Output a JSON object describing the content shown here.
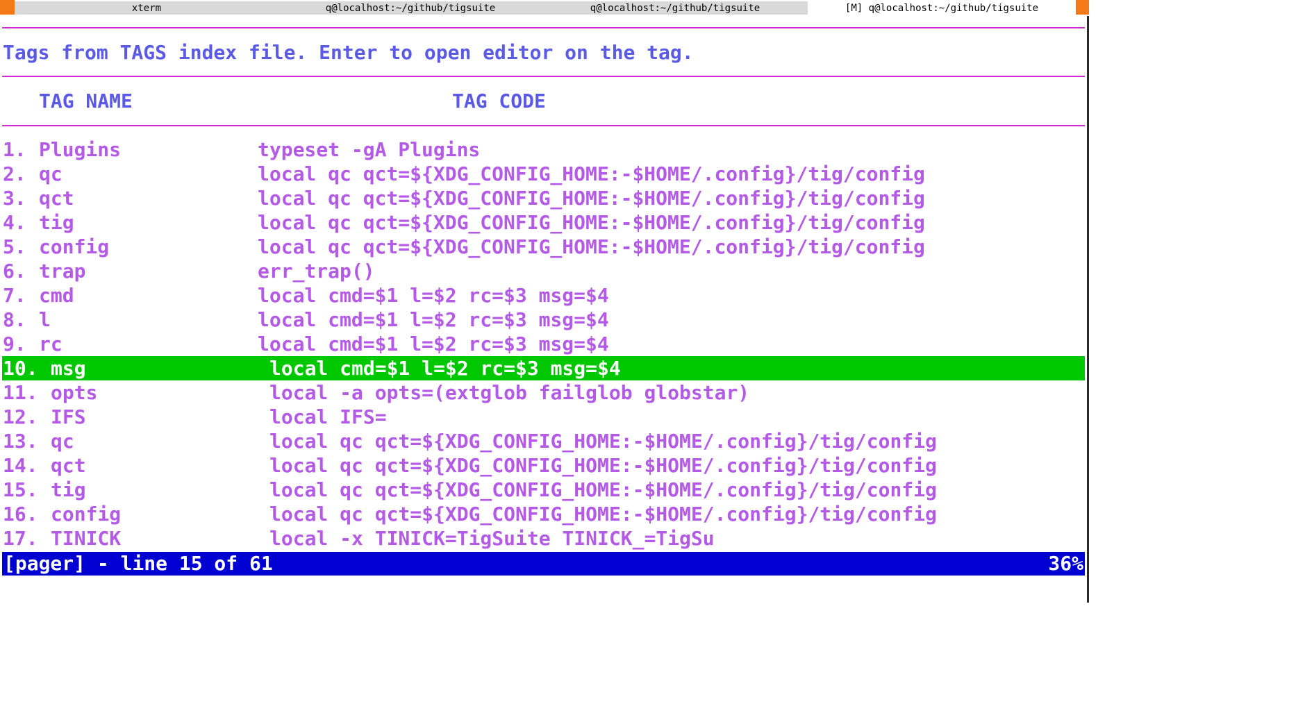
{
  "tabbar": {
    "tabs": [
      {
        "label": "xterm",
        "active": false
      },
      {
        "label": "q@localhost:~/github/tigsuite",
        "active": false
      },
      {
        "label": "q@localhost:~/github/tigsuite",
        "active": false
      },
      {
        "label": "[M] q@localhost:~/github/tigsuite",
        "active": true
      }
    ],
    "accent_color": "#f47a17"
  },
  "terminal": {
    "header": "Tags from TAGS index file. Enter to open editor on the tag.",
    "columns": {
      "tag_name": "TAG NAME",
      "tag_code": "TAG CODE"
    },
    "rows": [
      {
        "num": "1.",
        "name": "Plugins",
        "code": "typeset -gA Plugins"
      },
      {
        "num": "2.",
        "name": "qc",
        "code": "local qc qct=${XDG_CONFIG_HOME:-$HOME/.config}/tig/config"
      },
      {
        "num": "3.",
        "name": "qct",
        "code": "local qc qct=${XDG_CONFIG_HOME:-$HOME/.config}/tig/config"
      },
      {
        "num": "4.",
        "name": "tig",
        "code": "local qc qct=${XDG_CONFIG_HOME:-$HOME/.config}/tig/config"
      },
      {
        "num": "5.",
        "name": "config",
        "code": "local qc qct=${XDG_CONFIG_HOME:-$HOME/.config}/tig/config"
      },
      {
        "num": "6.",
        "name": "trap",
        "code": "err_trap()"
      },
      {
        "num": "7.",
        "name": "cmd",
        "code": "local cmd=$1 l=$2 rc=$3 msg=$4"
      },
      {
        "num": "8.",
        "name": "l",
        "code": "local cmd=$1 l=$2 rc=$3 msg=$4"
      },
      {
        "num": "9.",
        "name": "rc",
        "code": "local cmd=$1 l=$2 rc=$3 msg=$4"
      },
      {
        "num": "10.",
        "name": "msg",
        "code": "local cmd=$1 l=$2 rc=$3 msg=$4"
      },
      {
        "num": "11.",
        "name": "opts",
        "code": "local -a opts=(extglob failglob globstar)"
      },
      {
        "num": "12.",
        "name": "IFS",
        "code": "local IFS="
      },
      {
        "num": "13.",
        "name": "qc",
        "code": "local qc qct=${XDG_CONFIG_HOME:-$HOME/.config}/tig/config"
      },
      {
        "num": "14.",
        "name": "qct",
        "code": "local qc qct=${XDG_CONFIG_HOME:-$HOME/.config}/tig/config"
      },
      {
        "num": "15.",
        "name": "tig",
        "code": "local qc qct=${XDG_CONFIG_HOME:-$HOME/.config}/tig/config"
      },
      {
        "num": "16.",
        "name": "config",
        "code": "local qc qct=${XDG_CONFIG_HOME:-$HOME/.config}/tig/config"
      },
      {
        "num": "17.",
        "name": "TINICK",
        "code": "local -x TINICK=TigSuite TINICK_=TigSu"
      }
    ],
    "selected_row": "10.",
    "status": {
      "left": "[pager] - line 15 of 61",
      "right": "36%"
    },
    "colors": {
      "header_text": "#5a5ae6",
      "rule": "#d22ad2",
      "row_text": "#b45ae6",
      "selected_bg": "#00c800",
      "status_bg": "#0000d2"
    }
  }
}
